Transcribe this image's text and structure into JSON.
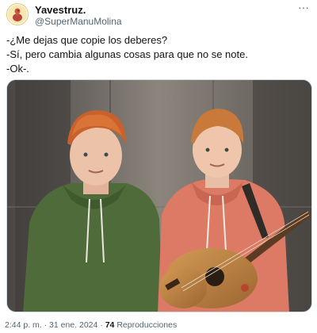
{
  "tweet": {
    "display_name": "Yavestruz.",
    "handle": "@SuperManuMolina",
    "text_lines": [
      "-¿Me dejas que copie los deberes?",
      "-Sí, pero cambia algunas cosas para que no se note.",
      "-Ok-."
    ],
    "time": "2:44 p. m.",
    "separator": "·",
    "date": "31 ene. 2024",
    "views_count": "74",
    "views_label": "Reproducciones"
  },
  "icons": {
    "avatar": "ostrich-avatar-icon",
    "more": "more-options-icon"
  },
  "colors": {
    "text_primary": "#0f1419",
    "text_secondary": "#536471",
    "border": "#cfd9de"
  }
}
